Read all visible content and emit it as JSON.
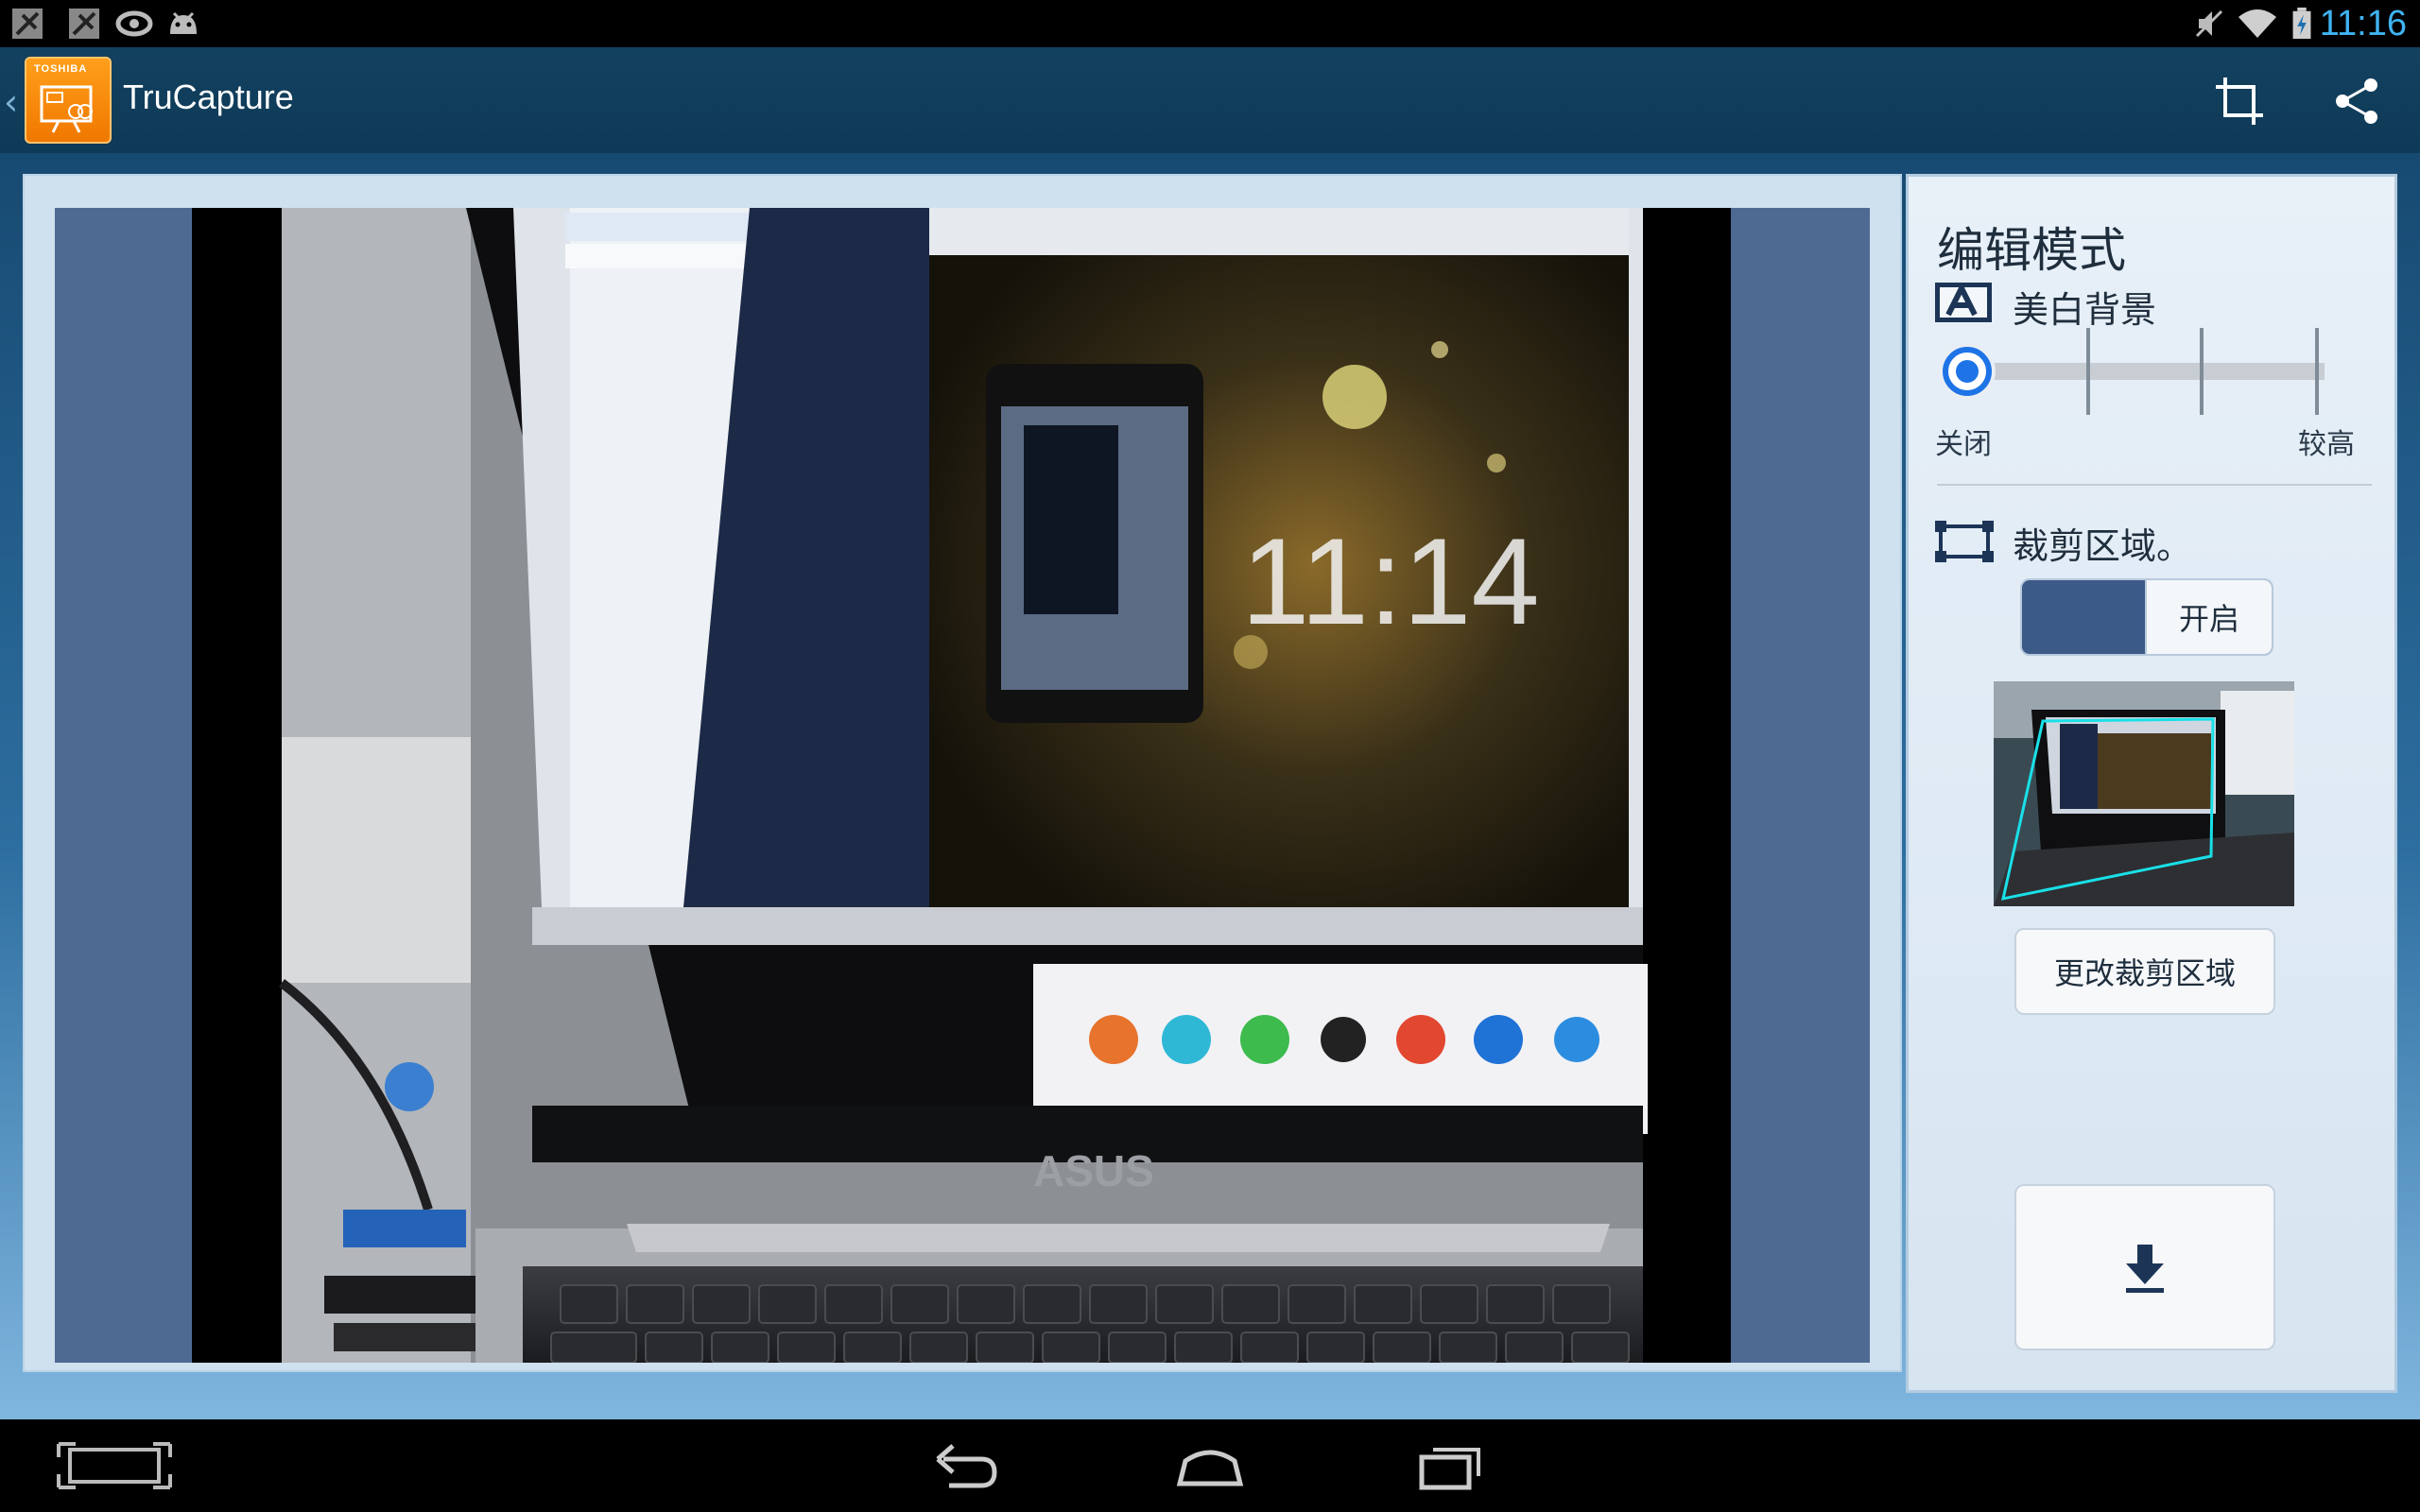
{
  "status_bar": {
    "notification_icons": [
      "usb-debug-icon",
      "usb-debug-icon",
      "nvidia-icon",
      "android-icon"
    ],
    "system_icons": [
      "mute-icon",
      "wifi-icon",
      "battery-charging-icon"
    ],
    "time": "11:16"
  },
  "action_bar": {
    "logo_brand": "TOSHIBA",
    "title": "TruCapture",
    "actions": [
      "crop-icon",
      "share-icon"
    ]
  },
  "edit_panel": {
    "title": "编辑模式",
    "whiteboard": {
      "icon": "text-background-icon",
      "label": "美白背景",
      "slider_min_label": "关闭",
      "slider_max_label": "较高",
      "slider_level": 0
    },
    "crop": {
      "icon": "crop-area-icon",
      "label": "裁剪区域。",
      "toggle_on_label": "开启"
    },
    "change_crop_label": "更改裁剪区域",
    "save_icon": "download-icon"
  },
  "nav_bar": [
    "screenshot-icon",
    "back-icon",
    "home-icon",
    "recent-apps-icon"
  ]
}
